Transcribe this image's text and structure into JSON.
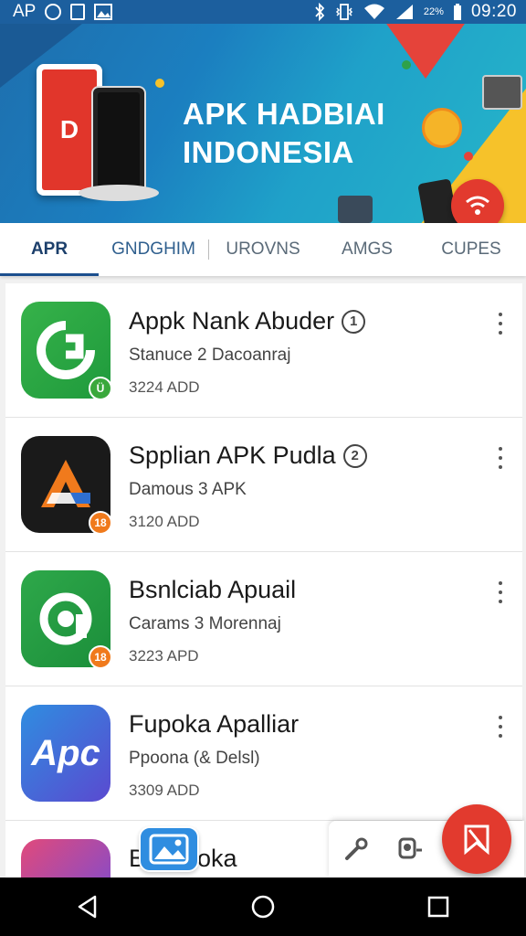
{
  "status_bar": {
    "left_text": "AP",
    "time": "09:20",
    "icons": [
      "circle-notification-icon",
      "box-notification-icon",
      "image-notification-icon",
      "bluetooth-icon",
      "vibrate-icon",
      "wifi-icon",
      "signal-icon"
    ],
    "data_rate": "22%"
  },
  "banner": {
    "title_line1": "APK HADBIAI",
    "title_line2": "INDONESIA",
    "phone_text": "D",
    "wifi_glyph": "📶"
  },
  "tabs": [
    {
      "label": "APR",
      "active": true
    },
    {
      "label": "GNDGHIM",
      "active": false
    },
    {
      "label": "UROVNS",
      "active": false
    },
    {
      "label": "AMGS",
      "active": false
    },
    {
      "label": "CUPES",
      "active": false
    }
  ],
  "apps": [
    {
      "title": "Appk Nank Abuder",
      "info": "1",
      "subtitle": "Stanuce 2 Dacoanraj",
      "size": "3224 ADD",
      "icon": "green-swirl-icon",
      "badge": "Ü"
    },
    {
      "title": "Spplian APK Pudla",
      "info": "2",
      "subtitle": "Damous 3 APK",
      "size": "3120 ADD",
      "icon": "apk-a-logo-icon",
      "badge": "18"
    },
    {
      "title": "Bsnlciab Apuail",
      "info": "",
      "subtitle": "Carams 3 Morennaj",
      "size": "3223 APD",
      "icon": "green-target-icon",
      "badge": "18"
    },
    {
      "title": "Fupoka Apalliar",
      "info": "",
      "subtitle": "Ppoona (& Delsl)",
      "size": "3309 ADD",
      "icon": "apc-logo-icon",
      "icon_text": "Apc"
    },
    {
      "title": "Bltusdoka",
      "info": "",
      "subtitle": "",
      "size": "",
      "icon": "gradient-app-icon"
    }
  ],
  "floating_bar": {
    "icons": [
      "key-icon",
      "camera-icon",
      "bookmark-icon"
    ]
  },
  "nav_bar": {
    "icons": [
      "back-icon",
      "home-icon",
      "recents-icon"
    ]
  },
  "colors": {
    "banner_blue": "#1b7fc0",
    "accent_red": "#e23a2e",
    "tab_active": "#1c3f6b"
  }
}
